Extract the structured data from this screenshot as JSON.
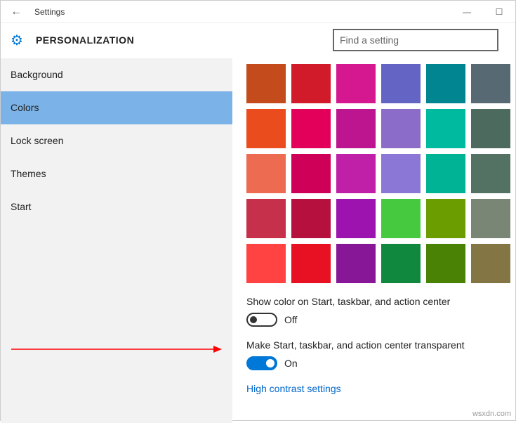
{
  "titlebar": {
    "title": "Settings",
    "back": "←",
    "min": "—",
    "max": "☐"
  },
  "header": {
    "gear": "⚙",
    "title": "PERSONALIZATION",
    "search_placeholder": "Find a setting"
  },
  "sidebar": {
    "items": [
      {
        "label": "Background",
        "selected": false
      },
      {
        "label": "Colors",
        "selected": true
      },
      {
        "label": "Lock screen",
        "selected": false
      },
      {
        "label": "Themes",
        "selected": false
      },
      {
        "label": "Start",
        "selected": false
      }
    ]
  },
  "main": {
    "swatches": [
      "#c44b1c",
      "#d11b2a",
      "#d61890",
      "#6364c4",
      "#008591",
      "#576a74",
      "#ea4c1e",
      "#e2005b",
      "#bc158f",
      "#8b6cc9",
      "#00ba9f",
      "#4c6a5d",
      "#ec6b51",
      "#ce0058",
      "#c020a7",
      "#8b77d6",
      "#00b394",
      "#537263",
      "#c6304a",
      "#b5103e",
      "#9c13b0",
      "#47c93f",
      "#6c9d00",
      "#7a8675",
      "#ff4343",
      "#e81123",
      "#881798",
      "#10893e",
      "#498205",
      "#847545"
    ],
    "setting1_label": "Show color on Start, taskbar, and action center",
    "setting1_value": "Off",
    "setting1_on": false,
    "setting2_label": "Make Start, taskbar, and action center transparent",
    "setting2_value": "On",
    "setting2_on": true,
    "link": "High contrast settings"
  },
  "watermark": "wsxdn.com"
}
